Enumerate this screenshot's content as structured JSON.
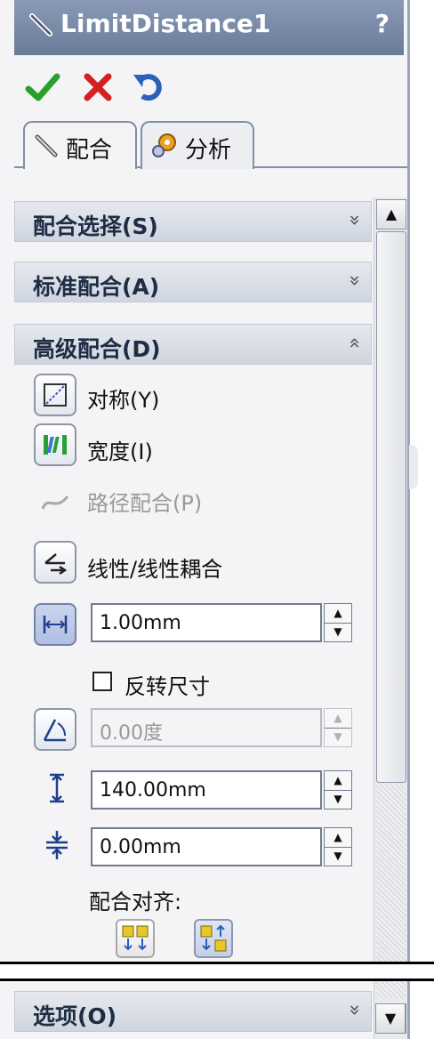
{
  "window": {
    "title": "LimitDistance1",
    "help_label": "?"
  },
  "actions": {
    "ok_icon": "checkmark-icon",
    "cancel_icon": "x-icon",
    "undo_icon": "undo-icon"
  },
  "tabs": [
    {
      "label": "配合",
      "icon": "paperclip-icon"
    },
    {
      "label": "分析",
      "icon": "analysis-icon"
    }
  ],
  "sections": {
    "mate_selection": {
      "title": "配合选择(S)",
      "chevron": "»"
    },
    "standard_mates": {
      "title": "标准配合(A)",
      "chevron": "»"
    },
    "advanced_mates": {
      "title": "高级配合(D)",
      "chevron": "«"
    },
    "options": {
      "title": "选项(O)",
      "chevron": "»"
    }
  },
  "advanced": {
    "symmetric": "对称(Y)",
    "width": "宽度(I)",
    "path_mate": "路径配合(P)",
    "linear_coupler": "线性/线性耦合",
    "distance_value": "1.00mm",
    "flip_dimension": "反转尺寸",
    "angle_value": "0.00度",
    "max_value": "140.00mm",
    "min_value": "0.00mm",
    "mate_alignment": "配合对齐:"
  },
  "colors": {
    "title_bar": "#7888a6",
    "section_header": "#d8dde6",
    "accent_green": "#2aa02a",
    "accent_red": "#d42020"
  }
}
